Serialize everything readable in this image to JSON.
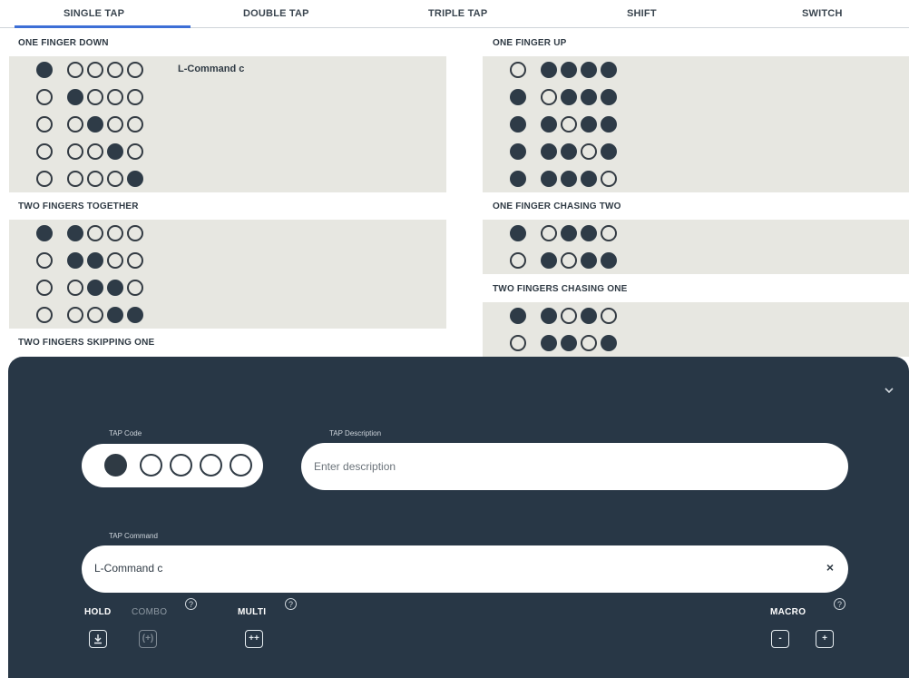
{
  "tabs": [
    {
      "label": "SINGLE TAP",
      "active": true
    },
    {
      "label": "DOUBLE TAP"
    },
    {
      "label": "TRIPLE TAP"
    },
    {
      "label": "SHIFT"
    },
    {
      "label": "SWITCH"
    }
  ],
  "accent_color": "#3d6fd6",
  "panel_color": "#283746",
  "sections": {
    "one_finger_down": {
      "title": "ONE FINGER DOWN",
      "rows": [
        {
          "dots": [
            1,
            0,
            0,
            0,
            0
          ],
          "command": "L-Command c"
        },
        {
          "dots": [
            0,
            1,
            0,
            0,
            0
          ],
          "command": ""
        },
        {
          "dots": [
            0,
            0,
            1,
            0,
            0
          ],
          "command": ""
        },
        {
          "dots": [
            0,
            0,
            0,
            1,
            0
          ],
          "command": ""
        },
        {
          "dots": [
            0,
            0,
            0,
            0,
            1
          ],
          "command": ""
        }
      ]
    },
    "one_finger_up": {
      "title": "ONE FINGER UP",
      "rows": [
        {
          "dots": [
            0,
            1,
            1,
            1,
            1
          ]
        },
        {
          "dots": [
            1,
            0,
            1,
            1,
            1
          ]
        },
        {
          "dots": [
            1,
            1,
            0,
            1,
            1
          ]
        },
        {
          "dots": [
            1,
            1,
            1,
            0,
            1
          ]
        },
        {
          "dots": [
            1,
            1,
            1,
            1,
            0
          ]
        }
      ]
    },
    "two_fingers_together": {
      "title": "TWO FINGERS TOGETHER",
      "rows": [
        {
          "dots": [
            1,
            1,
            0,
            0,
            0
          ]
        },
        {
          "dots": [
            0,
            1,
            1,
            0,
            0
          ]
        },
        {
          "dots": [
            0,
            0,
            1,
            1,
            0
          ]
        },
        {
          "dots": [
            0,
            0,
            0,
            1,
            1
          ]
        }
      ]
    },
    "one_finger_chasing_two": {
      "title": "ONE FINGER CHASING TWO",
      "rows": [
        {
          "dots": [
            1,
            0,
            1,
            1,
            0
          ]
        },
        {
          "dots": [
            0,
            1,
            0,
            1,
            1
          ]
        }
      ]
    },
    "two_fingers_chasing_one": {
      "title": "TWO FINGERS CHASING ONE",
      "rows": [
        {
          "dots": [
            1,
            1,
            0,
            1,
            0
          ]
        },
        {
          "dots": [
            0,
            1,
            1,
            0,
            1
          ]
        }
      ]
    },
    "two_fingers_skipping_one": {
      "title": "TWO FINGERS SKIPPING ONE"
    }
  },
  "editor": {
    "collapse_icon": "chevron-down-icon",
    "tap_code_label": "TAP Code",
    "tap_code_dots": [
      1,
      0,
      0,
      0,
      0
    ],
    "tap_description_label": "TAP Description",
    "tap_description_placeholder": "Enter description",
    "tap_description_value": "",
    "tap_command_label": "TAP Command",
    "tap_command_value": "L-Command c",
    "clear_glyph": "×",
    "hold_label": "HOLD",
    "combo_label": "COMBO",
    "multi_label": "MULTI",
    "macro_label": "MACRO",
    "help_glyph": "?",
    "combo_glyph": "(+)",
    "multi_glyph": "++",
    "macro_minus_glyph": "-",
    "macro_plus_glyph": "+"
  }
}
